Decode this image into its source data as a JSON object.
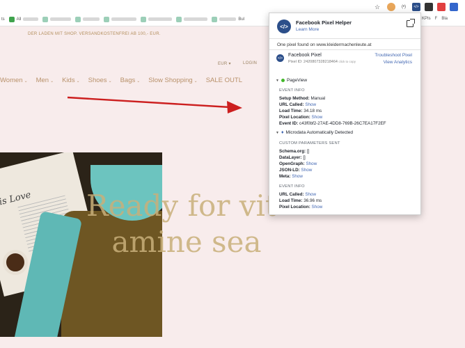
{
  "browser": {
    "bookmarks": [
      {
        "label": "ts"
      },
      {
        "label": "All"
      },
      {
        "label": ""
      },
      {
        "label": ""
      },
      {
        "label": ""
      },
      {
        "label": ""
      },
      {
        "label": ""
      },
      {
        "label": ""
      },
      {
        "label": "Bul"
      }
    ],
    "bookmarks_right": [
      "KPIs",
      "F",
      "Bla"
    ],
    "extension_labels": {
      "ext_a": "(•)",
      "ext_b": "</>"
    }
  },
  "site": {
    "promo": "DER LADEN MIT SHOP. VERSANDKOSTENFREI AB 100,- EUR.",
    "currency": "EUR",
    "login": "LOGIN",
    "nav": [
      "Women",
      "Men",
      "Kids",
      "Shoes",
      "Bags",
      "Slow Shopping",
      "SALE OUTL"
    ],
    "hero_lines": [
      "Ready for vit-",
      "amine sea"
    ],
    "magazine_title": "er is Love"
  },
  "popup": {
    "title": "Facebook Pixel Helper",
    "learn_more": "Learn More",
    "found_text": "One pixel found on www.kleidermachenleute.at",
    "pixel": {
      "name": "Facebook Pixel",
      "id_label": "Pixel ID: 2420807328218464",
      "copy_hint": "click to copy",
      "troubleshoot": "Troubleshoot Pixel",
      "view_analytics": "View Analytics"
    },
    "event1": {
      "name": "PageView",
      "section": "EVENT INFO",
      "rows": [
        {
          "key": "Setup Method:",
          "value": "Manual",
          "link": false
        },
        {
          "key": "URL Called:",
          "value": "Show",
          "link": true
        },
        {
          "key": "Load Time:",
          "value": "34.18 ms",
          "link": false
        },
        {
          "key": "Pixel Location:",
          "value": "Show",
          "link": true
        },
        {
          "key": "Event ID:",
          "value": "c43f0bf2-27AE-4DD8-769B-26C7EA17F2EF",
          "link": false
        }
      ]
    },
    "event2": {
      "name": "Microdata Automatically Detected",
      "section": "CUSTOM PARAMETERS SENT",
      "rows": [
        {
          "key": "Schema.org:",
          "value": "[]",
          "link": false
        },
        {
          "key": "DataLayer:",
          "value": "[]",
          "link": false
        },
        {
          "key": "OpenGraph:",
          "value": "Show",
          "link": true
        },
        {
          "key": "JSON-LD:",
          "value": "Show",
          "link": true
        },
        {
          "key": "Meta:",
          "value": "Show",
          "link": true
        }
      ],
      "section2": "EVENT INFO",
      "rows2": [
        {
          "key": "URL Called:",
          "value": "Show",
          "link": true
        },
        {
          "key": "Load Time:",
          "value": "36.96 ms",
          "link": false
        },
        {
          "key": "Pixel Location:",
          "value": "Show",
          "link": true
        }
      ]
    }
  },
  "colors": {
    "accent": "#4267b2",
    "gold": "#c9b07a",
    "site_bg": "#f8ecec",
    "arrow": "#cc1f1f"
  }
}
